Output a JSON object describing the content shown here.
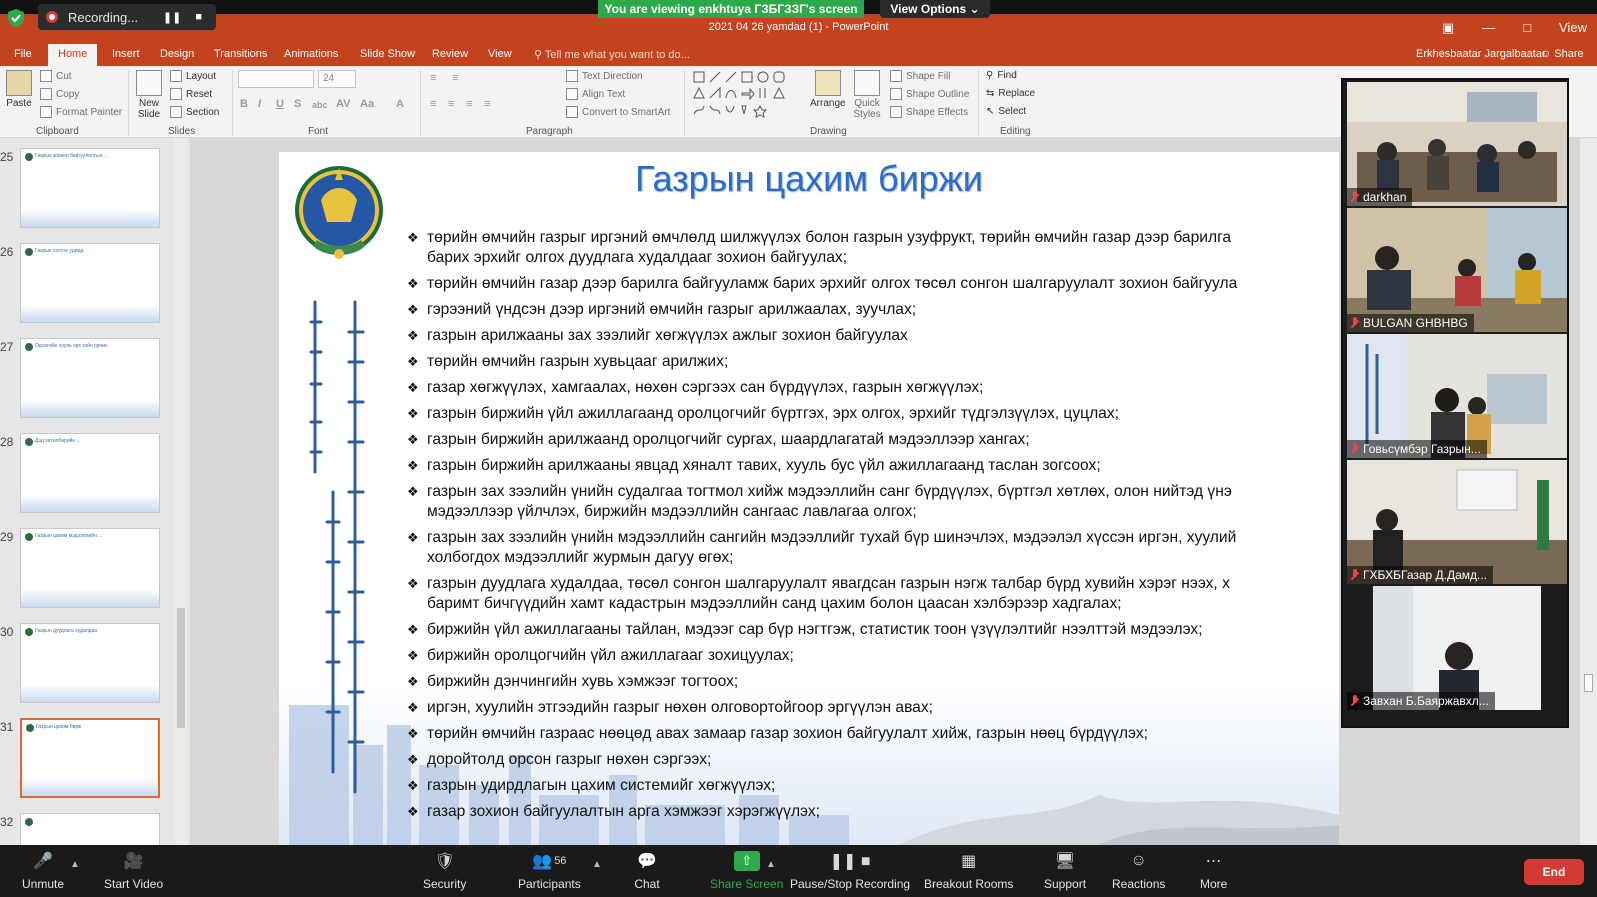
{
  "zoom_top": {
    "recording_label": "Recording...",
    "viewing_banner": "You are viewing enkhtuya ГЗБГЗЗГ's screen",
    "view_options": "View Options",
    "view_corner": "View"
  },
  "powerpoint": {
    "title": "2021 04 26 yamdad (1) - PowerPoint",
    "tabs": [
      "File",
      "Home",
      "Insert",
      "Design",
      "Transitions",
      "Animations",
      "Slide Show",
      "Review",
      "View"
    ],
    "active_tab": "Home",
    "tell_me": "Tell me what you want to do...",
    "user_name": "Erkhesbaatar Jargalbaatar",
    "share": "Share",
    "ribbon": {
      "clipboard": {
        "paste": "Paste",
        "cut": "Cut",
        "copy": "Copy",
        "format_painter": "Format Painter",
        "label": "Clipboard"
      },
      "slides": {
        "new_slide": "New Slide",
        "layout": "Layout",
        "reset": "Reset",
        "section": "Section",
        "label": "Slides"
      },
      "font": {
        "size": "24",
        "label": "Font"
      },
      "paragraph": {
        "text_direction": "Text Direction",
        "align_text": "Align Text",
        "convert_smartart": "Convert to SmartArt",
        "label": "Paragraph"
      },
      "drawing": {
        "arrange": "Arrange",
        "quick_styles": "Quick Styles",
        "shape_fill": "Shape Fill",
        "shape_outline": "Shape Outline",
        "shape_effects": "Shape Effects",
        "label": "Drawing"
      },
      "editing": {
        "find": "Find",
        "replace": "Replace",
        "select": "Select",
        "label": "Editing"
      }
    }
  },
  "slide_pane": {
    "thumbnails": [
      {
        "num": "25",
        "title": "Газрын зохион байгуулалтын ..."
      },
      {
        "num": "26",
        "title": "Газрын хэлтэс удирд"
      },
      {
        "num": "27",
        "title": "Одоогийн хууль эрх зүйн орчин"
      },
      {
        "num": "28",
        "title": "Дэд хөтөлбөрийн ..."
      },
      {
        "num": "29",
        "title": "Газрын цахим мэдээллийн ..."
      },
      {
        "num": "30",
        "title": "Газрын дуудлага худалдаа"
      },
      {
        "num": "31",
        "title": "Газрын цахим бирж"
      },
      {
        "num": "32",
        "title": ""
      }
    ],
    "selected": "31"
  },
  "slide": {
    "title": "Газрын цахим биржи",
    "bullets": [
      [
        "төрийн өмчийн газрыг иргэний өмчлөлд шилжүүлэх болон газрын узуфрукт, төрийн өмчийн газар дээр барилга",
        "барих эрхийг олгох дуудлага худалдааг зохион байгуулах;"
      ],
      [
        "төрийн өмчийн газар дээр барилга байгууламж барих эрхийг олгох төсөл сонгон шалгаруулалт зохион байгуула"
      ],
      [
        "гэрээний үндсэн дээр иргэний өмчийн газрыг арилжаалах, зуучлах;"
      ],
      [
        "газрын арилжааны зах зээлийг хөгжүүлэх ажлыг зохион байгуулах"
      ],
      [
        "төрийн өмчийн газрын хувьцааг арилжих;"
      ],
      [
        "газар хөгжүүлэх, хамгаалах, нөхөн сэргээх сан бүрдүүлэх, газрын хөгжүүлэх;"
      ],
      [
        "газрын биржийн үйл ажиллагаанд оролцогчийг бүртгэх, эрх олгох, эрхийг түдгэлзүүлэх, цуцлах;"
      ],
      [
        "газрын биржийн арилжаанд оролцогчийг сургах, шаардлагатай мэдээллээр хангах;"
      ],
      [
        "газрын биржийн арилжааны явцад хяналт тавих, хууль бус үйл ажиллагаанд таслан зогсоох;"
      ],
      [
        "газрын зах зээлийн үнийн судалгаа тогтмол хийж мэдээллийн санг бүрдүүлэх, бүртгэл хөтлөх, олон нийтэд үнэ",
        "мэдээллээр үйлчлэх, биржийн мэдээллийн сангаас лавлагаа олгох;"
      ],
      [
        "газрын зах зээлийн үнийн мэдээллийн сангийн мэдээллийг тухай бүр шинэчлэх, мэдээлэл хүссэн иргэн, хуулий",
        "холбогдох мэдээллийг журмын дагуу өгөх;"
      ],
      [
        "газрын дуудлага худалдаа, төсөл сонгон шалгаруулалт явагдсан газрын нэгж талбар бүрд хувийн хэрэг нээх, х",
        "баримт бичгүүдийн хамт кадастрын мэдээллийн санд цахим болон цаасан хэлбэрээр хадгалах;"
      ],
      [
        "биржийн үйл ажиллагааны тайлан, мэдээг сар бүр нэгтгэж, статистик тоон үзүүлэлтийг нээлттэй мэдээлэх;"
      ],
      [
        "биржийн оролцогчийн үйл ажиллагааг зохицуулах;"
      ],
      [
        "биржийн дэнчингийн хувь хэмжээг тогтоох;"
      ],
      [
        "иргэн, хуулийн этгээдийн газрыг нөхөн олговортойгоор эргүүлэн авах;"
      ],
      [
        "төрийн өмчийн газраас нөөцөд авах замаар газар зохион байгуулалт хийж, газрын нөөц бүрдүүлэх;"
      ],
      [
        "доройтолд орсон газрыг нөхөн сэргээх;"
      ],
      [
        "газрын удирдлагын цахим системийг хөгжүүлэх;"
      ],
      [
        "газар зохион байгуулалтын арга хэмжээг хэрэгжүүлэх;"
      ]
    ]
  },
  "gallery": {
    "participants": [
      {
        "name": "darkhan"
      },
      {
        "name": "BULGAN GHBHBG"
      },
      {
        "name": "Говьсүмбэр Газрын..."
      },
      {
        "name": "ГХБХБГазар Д.Дамд..."
      },
      {
        "name": "Завхан Б.Баяржавхл..."
      }
    ]
  },
  "zoom_bottom": {
    "unmute": "Unmute",
    "start_video": "Start Video",
    "security": "Security",
    "participants": "Participants",
    "participants_count": "56",
    "chat": "Chat",
    "share_screen": "Share Screen",
    "pause_stop_recording": "Pause/Stop Recording",
    "breakout_rooms": "Breakout Rooms",
    "support": "Support",
    "reactions": "Reactions",
    "more": "More",
    "end": "End"
  },
  "colors": {
    "ppt_accent": "#c4431f",
    "share_green": "#2ea94a",
    "end_red": "#d33a33",
    "slide_title_blue": "#2b6cc4"
  }
}
